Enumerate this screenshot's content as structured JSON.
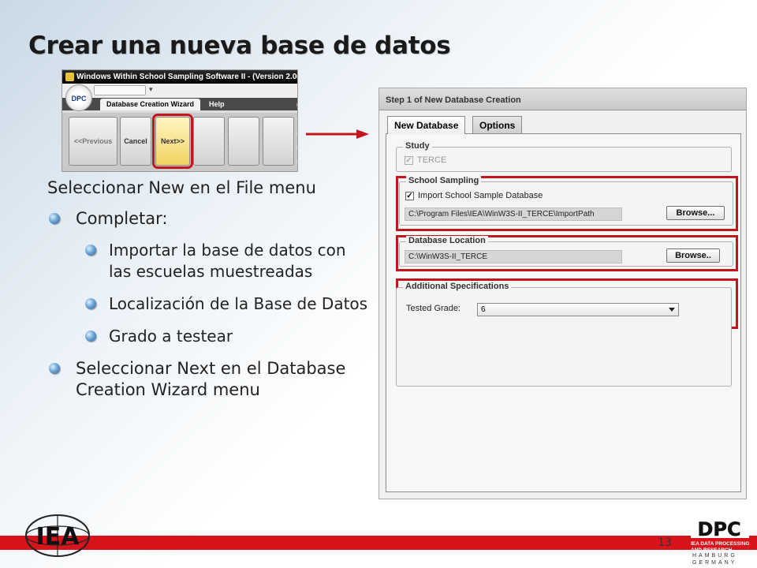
{
  "slide": {
    "title": "Crear una nueva base de datos",
    "page_number": "13"
  },
  "toolbar": {
    "window_title": "Windows Within School Sampling Software II - (Version 2.0.0)",
    "logo_text": "DPC",
    "dropdown_glyph": "▾",
    "tabs": [
      {
        "label": "Database Creation Wizard",
        "active": true
      },
      {
        "label": "Help",
        "active": false
      }
    ],
    "buttons": {
      "previous": "<<Previous",
      "cancel": "Cancel",
      "next": "Next>>"
    }
  },
  "bullets": {
    "intro": "Seleccionar New en el File menu",
    "complete": "Completar:",
    "sub1": "Importar la base de datos con las escuelas muestreadas",
    "sub2": "Localización de la Base de Datos",
    "sub3": "Grado a testear",
    "next_step": "Seleccionar Next en el Database Creation Wizard menu"
  },
  "dialog": {
    "header": "Step 1 of New Database Creation",
    "tabs": [
      {
        "label": "New Database",
        "active": true
      },
      {
        "label": "Options",
        "active": false
      }
    ],
    "study": {
      "title": "Study",
      "checkbox_label": "TERCE",
      "checked": true,
      "enabled": false
    },
    "school_sampling": {
      "title": "School Sampling",
      "checkbox_label": "Import School Sample Database",
      "checked": true,
      "path": "C:\\Program Files\\IEA\\WinW3S-II_TERCE\\ImportPath",
      "browse_label": "Browse..."
    },
    "database_location": {
      "title": "Database Location",
      "path": "C:\\WinW3S-II_TERCE",
      "browse_label": "Browse.."
    },
    "additional_specifications": {
      "title": "Additional Specifications",
      "grade_label": "Tested Grade:",
      "grade_value": "6"
    }
  },
  "footer": {
    "dpc_logo": "DPC",
    "dpc_subtitle": "IEA DATA PROCESSING AND RESEARCH CENTER",
    "dpc_city": "HAMBURG",
    "dpc_country": "GERMANY",
    "iea_logo": "IEA"
  },
  "colors": {
    "accent_red": "#c3161c",
    "footer_red": "#d7141b",
    "bullet_blue": "#2a5f94"
  }
}
